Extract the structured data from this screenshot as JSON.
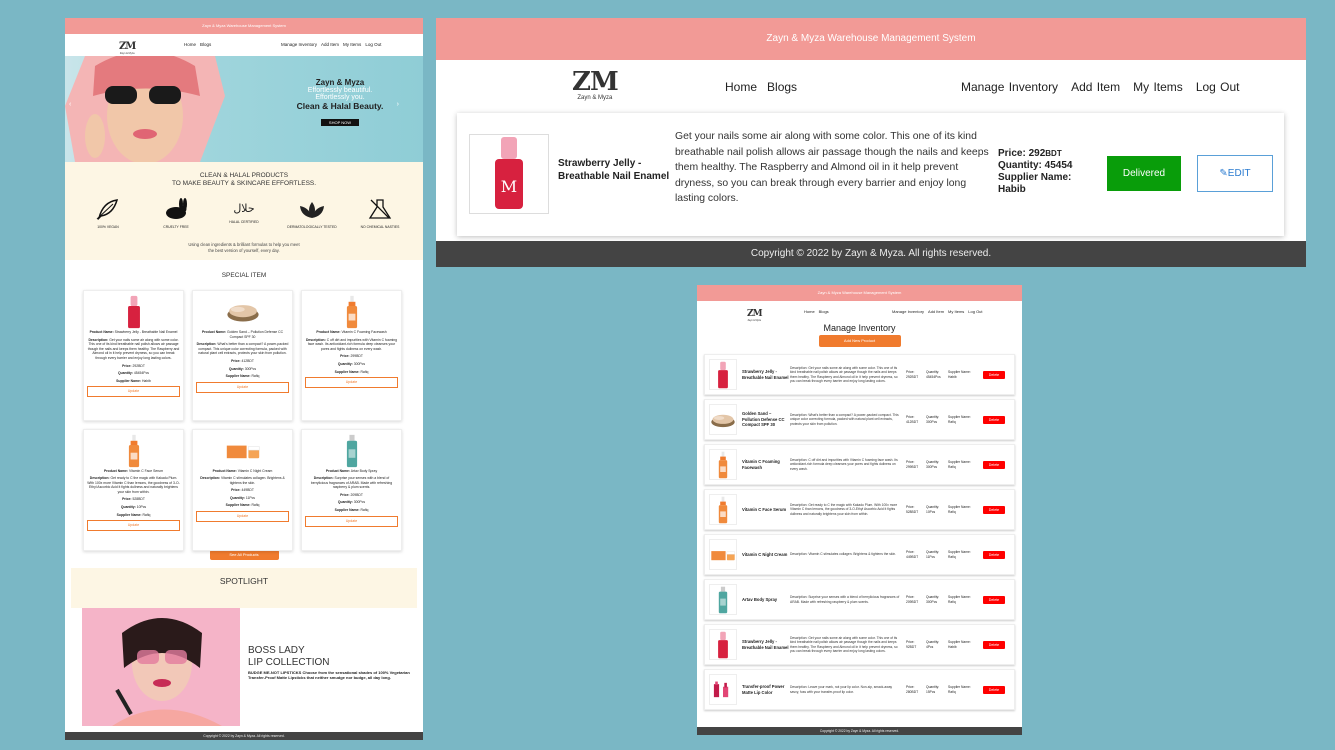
{
  "app_title": "Zayn & Myza Warehouse Management System",
  "logo": {
    "mark": "ZM",
    "sub": "Zayn & Myza"
  },
  "nav": {
    "home": "Home",
    "blogs": "Blogs",
    "manage": "Manage Inventory",
    "add": "Add Item",
    "my": "My Items",
    "logout": "Log Out"
  },
  "copyright": "Copyright © 2022 by Zayn & Myza. All rights reserved.",
  "hero": {
    "brand": "Zayn & Myza",
    "line1": "Effortlessly beautiful.",
    "line2": "Effortlessly you.",
    "line3": "Clean & Halal Beauty.",
    "cta": "SHOP NOW"
  },
  "clean": {
    "title1": "CLEAN & HALAL PRODUCTS",
    "title2": "TO MAKE BEAUTY & SKINCARE EFFORTLESS.",
    "badges": [
      "100% VEGAN",
      "CRUELTY FREE",
      "HALAL CERTIFIED",
      "DERMATOLOGICALLY TESTED",
      "NO CHEMICAL NASTIES"
    ],
    "halal_glyph": "حلال",
    "note1": "Using clean ingredients & brilliant formulas to help you meet",
    "note2": "the best version of yourself, every day."
  },
  "special": {
    "title": "SPECIAL ITEM",
    "labels": {
      "name": "Product Name:",
      "desc": "Description:",
      "price": "Price:",
      "qty": "Quantity:",
      "supplier": "Supplier Name:",
      "update": "Update"
    },
    "items": [
      {
        "name": "Strawberry Jelly - Breathable Nail Enamel",
        "desc": "Get your nails some air along with some color. This one of its kind breathable nail polish allows air passage though the nails and keeps them healthy. The Raspberry and Almond oil in it help prevent dryness, so you can break through every barrier and enjoy long lasting colors.",
        "price": "292BDT",
        "qty": "45454Pcs",
        "supplier": "Habib"
      },
      {
        "name": "Golden Sand – Pollution Defense CC Compact SPF 30",
        "desc": "What's better than a compact? A power-packed compact. This unique color correcting formula, packed with natural plant cell extracts, protects your skin from pollution.",
        "price": "412BDT",
        "qty": "300Pcs",
        "supplier": "Rafiq"
      },
      {
        "name": "Vitamin C Foaming Facewash",
        "desc": "C off dirt and impurities with Vitamin C foaming face wash. Its antioxidant-rich formula deep cleanses your pores and fights dullness on every wash.",
        "price": "299BDT",
        "qty": "300Pcs",
        "supplier": "Rafiq"
      },
      {
        "name": "Vitamin C Face Serum",
        "desc": "Get ready to C the magic with Kakadu Plum. With 100x more Vitamin C than lemons, the goodness of 3-O-Ethyl Ascorbic Acid it fights dullness and naturally brightens your skin from within.",
        "price": "528BDT",
        "qty": "10Pcs",
        "supplier": "Rafiq"
      },
      {
        "name": "Vitamin C Night Cream",
        "desc": "Vitamin C stimulates collagen. Brightens & tightens the skin.",
        "price": "449BDT",
        "qty": "11Pcs",
        "supplier": "Rafiq"
      },
      {
        "name": "Artav Body Spray",
        "desc": "Surprise your senses with a blend of berrylicious fragrances of ARAB. Made with refreshing raspberry & plum scents.",
        "price": "209BDT",
        "qty": "300Pcs",
        "supplier": "Rafiq"
      }
    ],
    "see_all": "See All Products"
  },
  "spotlight": {
    "title": "SPOTLIGHT",
    "h1": "BOSS LADY",
    "h2": "LIP COLLECTION",
    "text": "BUDGE ME-NOT LIPSTICKS Choose from the sensational shades of 100% Vegetarian Transfer-Proof Matte Lipsticks that neither smudge nor budge, all day long."
  },
  "detail": {
    "name": "Strawberry Jelly - Breathable Nail Enamel",
    "desc": "Get your nails some air along with some color. This one of its kind breathable nail polish allows air passage though the nails and keeps them healthy. The Raspberry and Almond oil in it help prevent dryness, so you can break through every barrier and enjoy long lasting colors.",
    "price_label": "Price:",
    "price": "292",
    "price_unit": "BDT",
    "qty_label": "Quantity:",
    "qty": "45454",
    "supplier_label": "Supplier Name:",
    "supplier": "Habib",
    "status": "Delivered",
    "edit": "EDIT"
  },
  "manage": {
    "title": "Manage Inventory",
    "add_btn": "Add New Product",
    "labels": {
      "desc": "Description:",
      "price": "Price:",
      "qty": "Quantity:",
      "supplier": "Supplier Name:",
      "delete": "Delete"
    },
    "rows": [
      {
        "name": "Strawberry Jelly - Breathable Nail Enamel",
        "desc": "Get your nails some air along with some color. This one of its kind breathable nail polish allows air passage though the nails and keeps them healthy. The Raspberry and Almond oil in it help prevent dryness, so you can break through every barrier and enjoy long lasting colors.",
        "price": "292BDT",
        "qty": "45454Pcs",
        "supplier": "Habib"
      },
      {
        "name": "Golden Sand – Pollution Defense CC Compact SPF 30",
        "desc": "What's better than a compact? A power-packed compact. This unique color correcting formula, packed with natural plant cell extracts, protects your skin from pollution.",
        "price": "412BDT",
        "qty": "300Pcs",
        "supplier": "Rafiq"
      },
      {
        "name": "Vitamin C Foaming Facewash",
        "desc": "C off dirt and impurities with Vitamin C foaming face wash. Its antioxidant-rich formula deep cleanses your pores and fights dullness on every wash.",
        "price": "299BDT",
        "qty": "300Pcs",
        "supplier": "Rafiq"
      },
      {
        "name": "Vitamin C Face Serum",
        "desc": "Get ready to C the magic with Kakadu Plum. With 100x more Vitamin C than lemons, the goodness of 3-O-Ethyl Ascorbic Acid it fights dullness and naturally brightens your skin from within.",
        "price": "528BDT",
        "qty": "10Pcs",
        "supplier": "Rafiq"
      },
      {
        "name": "Vitamin C Night Cream",
        "desc": "Vitamin C stimulates collagen. Brightens & tightens the skin.",
        "price": "449BDT",
        "qty": "11Pcs",
        "supplier": "Rafiq"
      },
      {
        "name": "Artav Body Spray",
        "desc": "Surprise your senses with a blend of berrylicious fragrances of ARAB. Made with refreshing raspberry & plum scents.",
        "price": "209BDT",
        "qty": "300Pcs",
        "supplier": "Rafiq"
      },
      {
        "name": "Strawberry Jelly - Breathable Nail Enamel",
        "desc": "Get your nails some air along with some color. This one of its kind breathable nail polish allows air passage though the nails and keeps them healthy. The Raspberry and Almond oil in it help prevent dryness, so you can break through every barrier and enjoy long lasting colors.",
        "price": "92BDT",
        "qty": "4Pcs",
        "supplier": "Habib"
      },
      {
        "name": "Transfer-proof Power Matte Lip Color",
        "desc": "Leave your mark, not your lip color. Non-sip, smack-away savvy, fuss with your transfer-proof lip color.",
        "price": "280BDT",
        "qty": "15Pcs",
        "supplier": "Rafiq"
      }
    ]
  },
  "colors": {
    "pink": "#f29a96",
    "orange": "#f07b2e",
    "green": "#099d0a",
    "red": "#ff0000",
    "footer": "#444444",
    "teal": "#7ab7c5"
  }
}
